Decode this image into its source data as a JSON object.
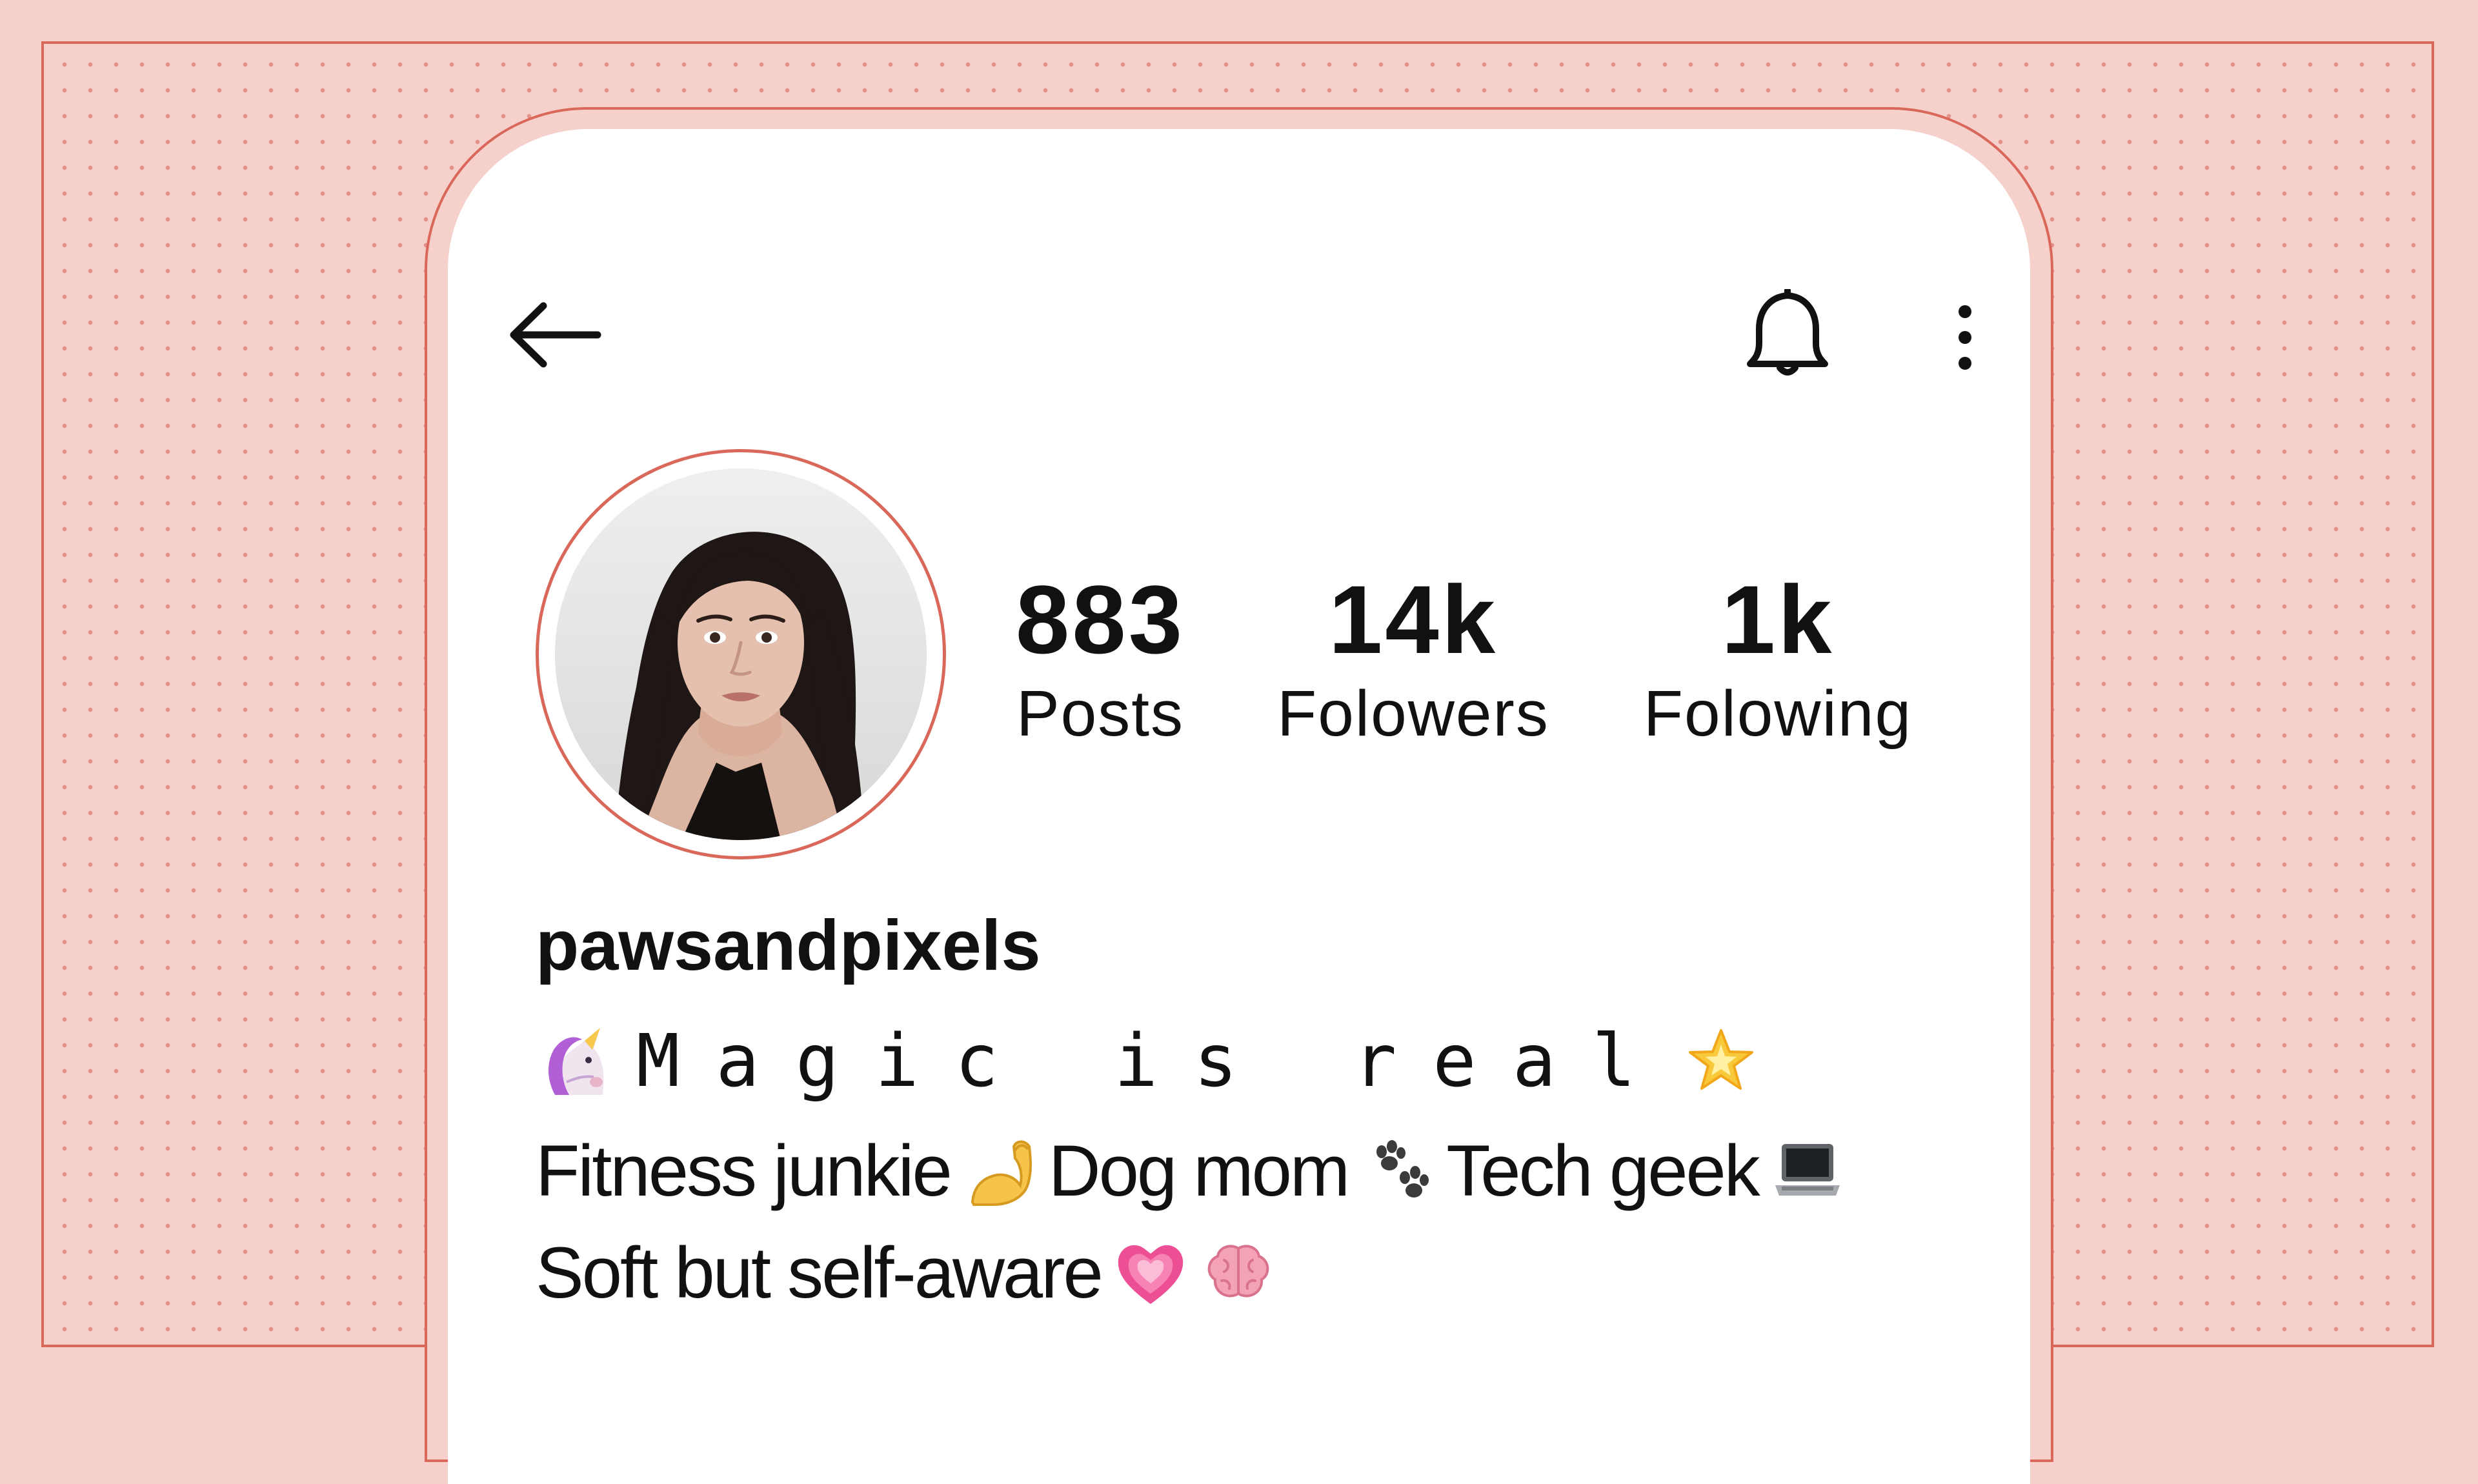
{
  "profile": {
    "username": "pawsandpixels",
    "avatar_alt": "Profile photo of a woman with long dark hair"
  },
  "stats": [
    {
      "value": "883",
      "label": "Posts"
    },
    {
      "value": "14k",
      "label": "Folowers"
    },
    {
      "value": "1k",
      "label": "Folowing"
    }
  ],
  "bio": {
    "line1": "Magic is real",
    "line2": [
      "Fitness junkie",
      "Dog mom",
      "Tech geek"
    ],
    "line3": "Soft but self-aware"
  },
  "icons": {
    "back": "arrow-left-icon",
    "bell": "bell-icon",
    "more": "more-vertical-icon",
    "bio_emoji": [
      "unicorn-icon",
      "glowing-star-icon",
      "flexed-biceps-icon",
      "paw-prints-icon",
      "laptop-icon",
      "growing-heart-icon",
      "brain-icon"
    ]
  },
  "colors": {
    "background": "#f6d0cb",
    "accent": "#d9685a",
    "card": "#ffffff",
    "text": "#111111"
  }
}
